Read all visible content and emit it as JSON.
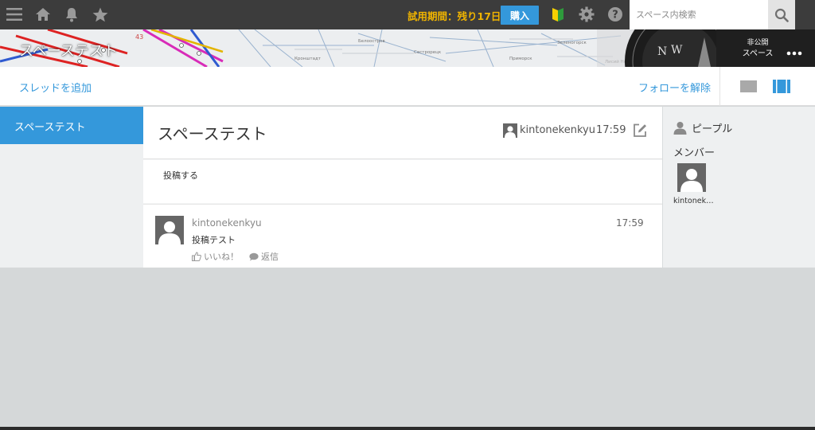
{
  "topbar": {
    "trial_text": "試用期間：残り17日",
    "buy_label": "購入",
    "search_placeholder": "スペース内検索",
    "icons": [
      "menu-icon",
      "home-icon",
      "bell-icon",
      "star-icon",
      "beginner-mark-icon",
      "gear-icon",
      "help-icon",
      "search-icon"
    ]
  },
  "banner": {
    "title": "スペーステスト",
    "visibility_line1": "非公開",
    "visibility_line2": "スペース"
  },
  "actionbar": {
    "add_thread": "スレッドを追加",
    "unfollow": "フォローを解除"
  },
  "leftnav": {
    "items": [
      {
        "label": "スペーステスト"
      }
    ]
  },
  "thread": {
    "title": "スペーステスト",
    "author": "kintonekenkyu",
    "time": "17:59",
    "post_prompt": "投稿する"
  },
  "comment": {
    "author": "kintonekenkyu",
    "time": "17:59",
    "body": "投稿テスト",
    "like_label": "いいね！",
    "reply_label": "返信"
  },
  "people": {
    "heading": "ピープル",
    "members_label": "メンバー",
    "members": [
      {
        "name": "kintonek…"
      }
    ]
  },
  "colors": {
    "accent": "#3498db",
    "topbar": "#3c3c3c",
    "trial": "#f0b400"
  }
}
